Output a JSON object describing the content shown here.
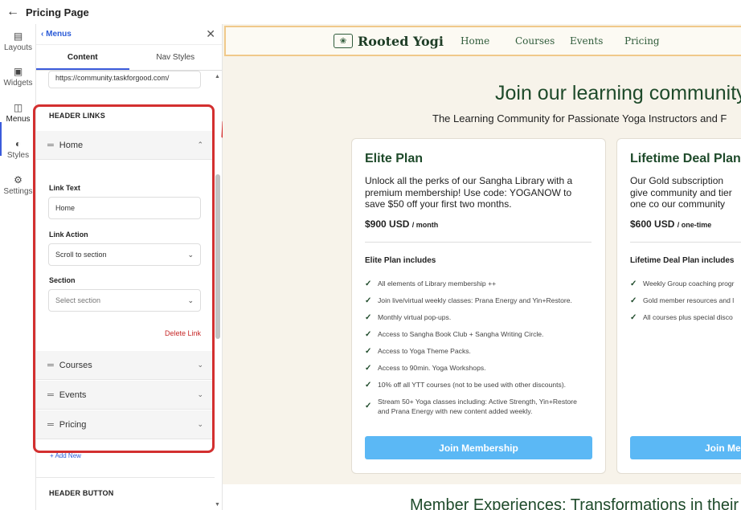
{
  "topbar": {
    "title": "Pricing Page"
  },
  "rail": {
    "items": [
      {
        "label": "Layouts"
      },
      {
        "label": "Widgets"
      },
      {
        "label": "Menus"
      },
      {
        "label": "Styles"
      },
      {
        "label": "Settings"
      }
    ]
  },
  "panel": {
    "back_label": "Menus",
    "tabs": [
      "Content",
      "Nav Styles"
    ],
    "url_value": "https://community.taskforgood.com/",
    "header_links_title": "HEADER LINKS",
    "links": [
      {
        "label": "Home"
      },
      {
        "label": "Courses"
      },
      {
        "label": "Events"
      },
      {
        "label": "Pricing"
      }
    ],
    "link_text_label": "Link Text",
    "link_text_value": "Home",
    "link_action_label": "Link Action",
    "link_action_value": "Scroll to section",
    "section_label": "Section",
    "section_placeholder": "Select section",
    "delete_link": "Delete Link",
    "add_new": "+ Add New",
    "header_button_title": "HEADER BUTTON"
  },
  "site": {
    "logo": "Rooted Yogi",
    "nav": [
      "Home",
      "Courses",
      "Events",
      "Pricing"
    ],
    "hero_title": "Join our learning community",
    "hero_sub": "The Learning Community for Passionate Yoga Instructors and F",
    "bottom_title": "Member Experiences: Transformations in their",
    "cards": [
      {
        "title": "Elite Plan",
        "desc": "Unlock all the perks of our Sangha Library with a premium membership! Use code: YOGANOW to save $50 off your first two months.",
        "price": "$900 USD",
        "per": "/ month",
        "includes": "Elite Plan includes",
        "features": [
          "All elements of Library membership ++",
          "Join live/virtual weekly classes: Prana Energy and Yin+Restore.",
          "Monthly virtual pop-ups.",
          "Access to Sangha Book Club + Sangha Writing Circle.",
          "Access to Yoga Theme Packs.",
          "Access to 90min. Yoga Workshops.",
          "10% off all YTT courses (not to be used with other discounts).",
          "Stream 50+ Yoga classes including: Active Strength, Yin+Restore and Prana Energy with new content added weekly."
        ],
        "button": "Join Membership"
      },
      {
        "title": "Lifetime Deal Plan",
        "desc": "Our Gold subscription give community and tier one co our community",
        "price": "$600 USD",
        "per": "/ one-time",
        "includes": "Lifetime Deal Plan includes",
        "features": [
          "Weekly Group coaching progr",
          "Gold member resources and l",
          "All courses plus special disco"
        ],
        "button": "Join Me"
      }
    ]
  },
  "colors": {
    "accent": "#3b5bdb",
    "highlight": "#d32f2f",
    "brand_green": "#1e4a2a",
    "button_blue": "#5bb8f5"
  }
}
